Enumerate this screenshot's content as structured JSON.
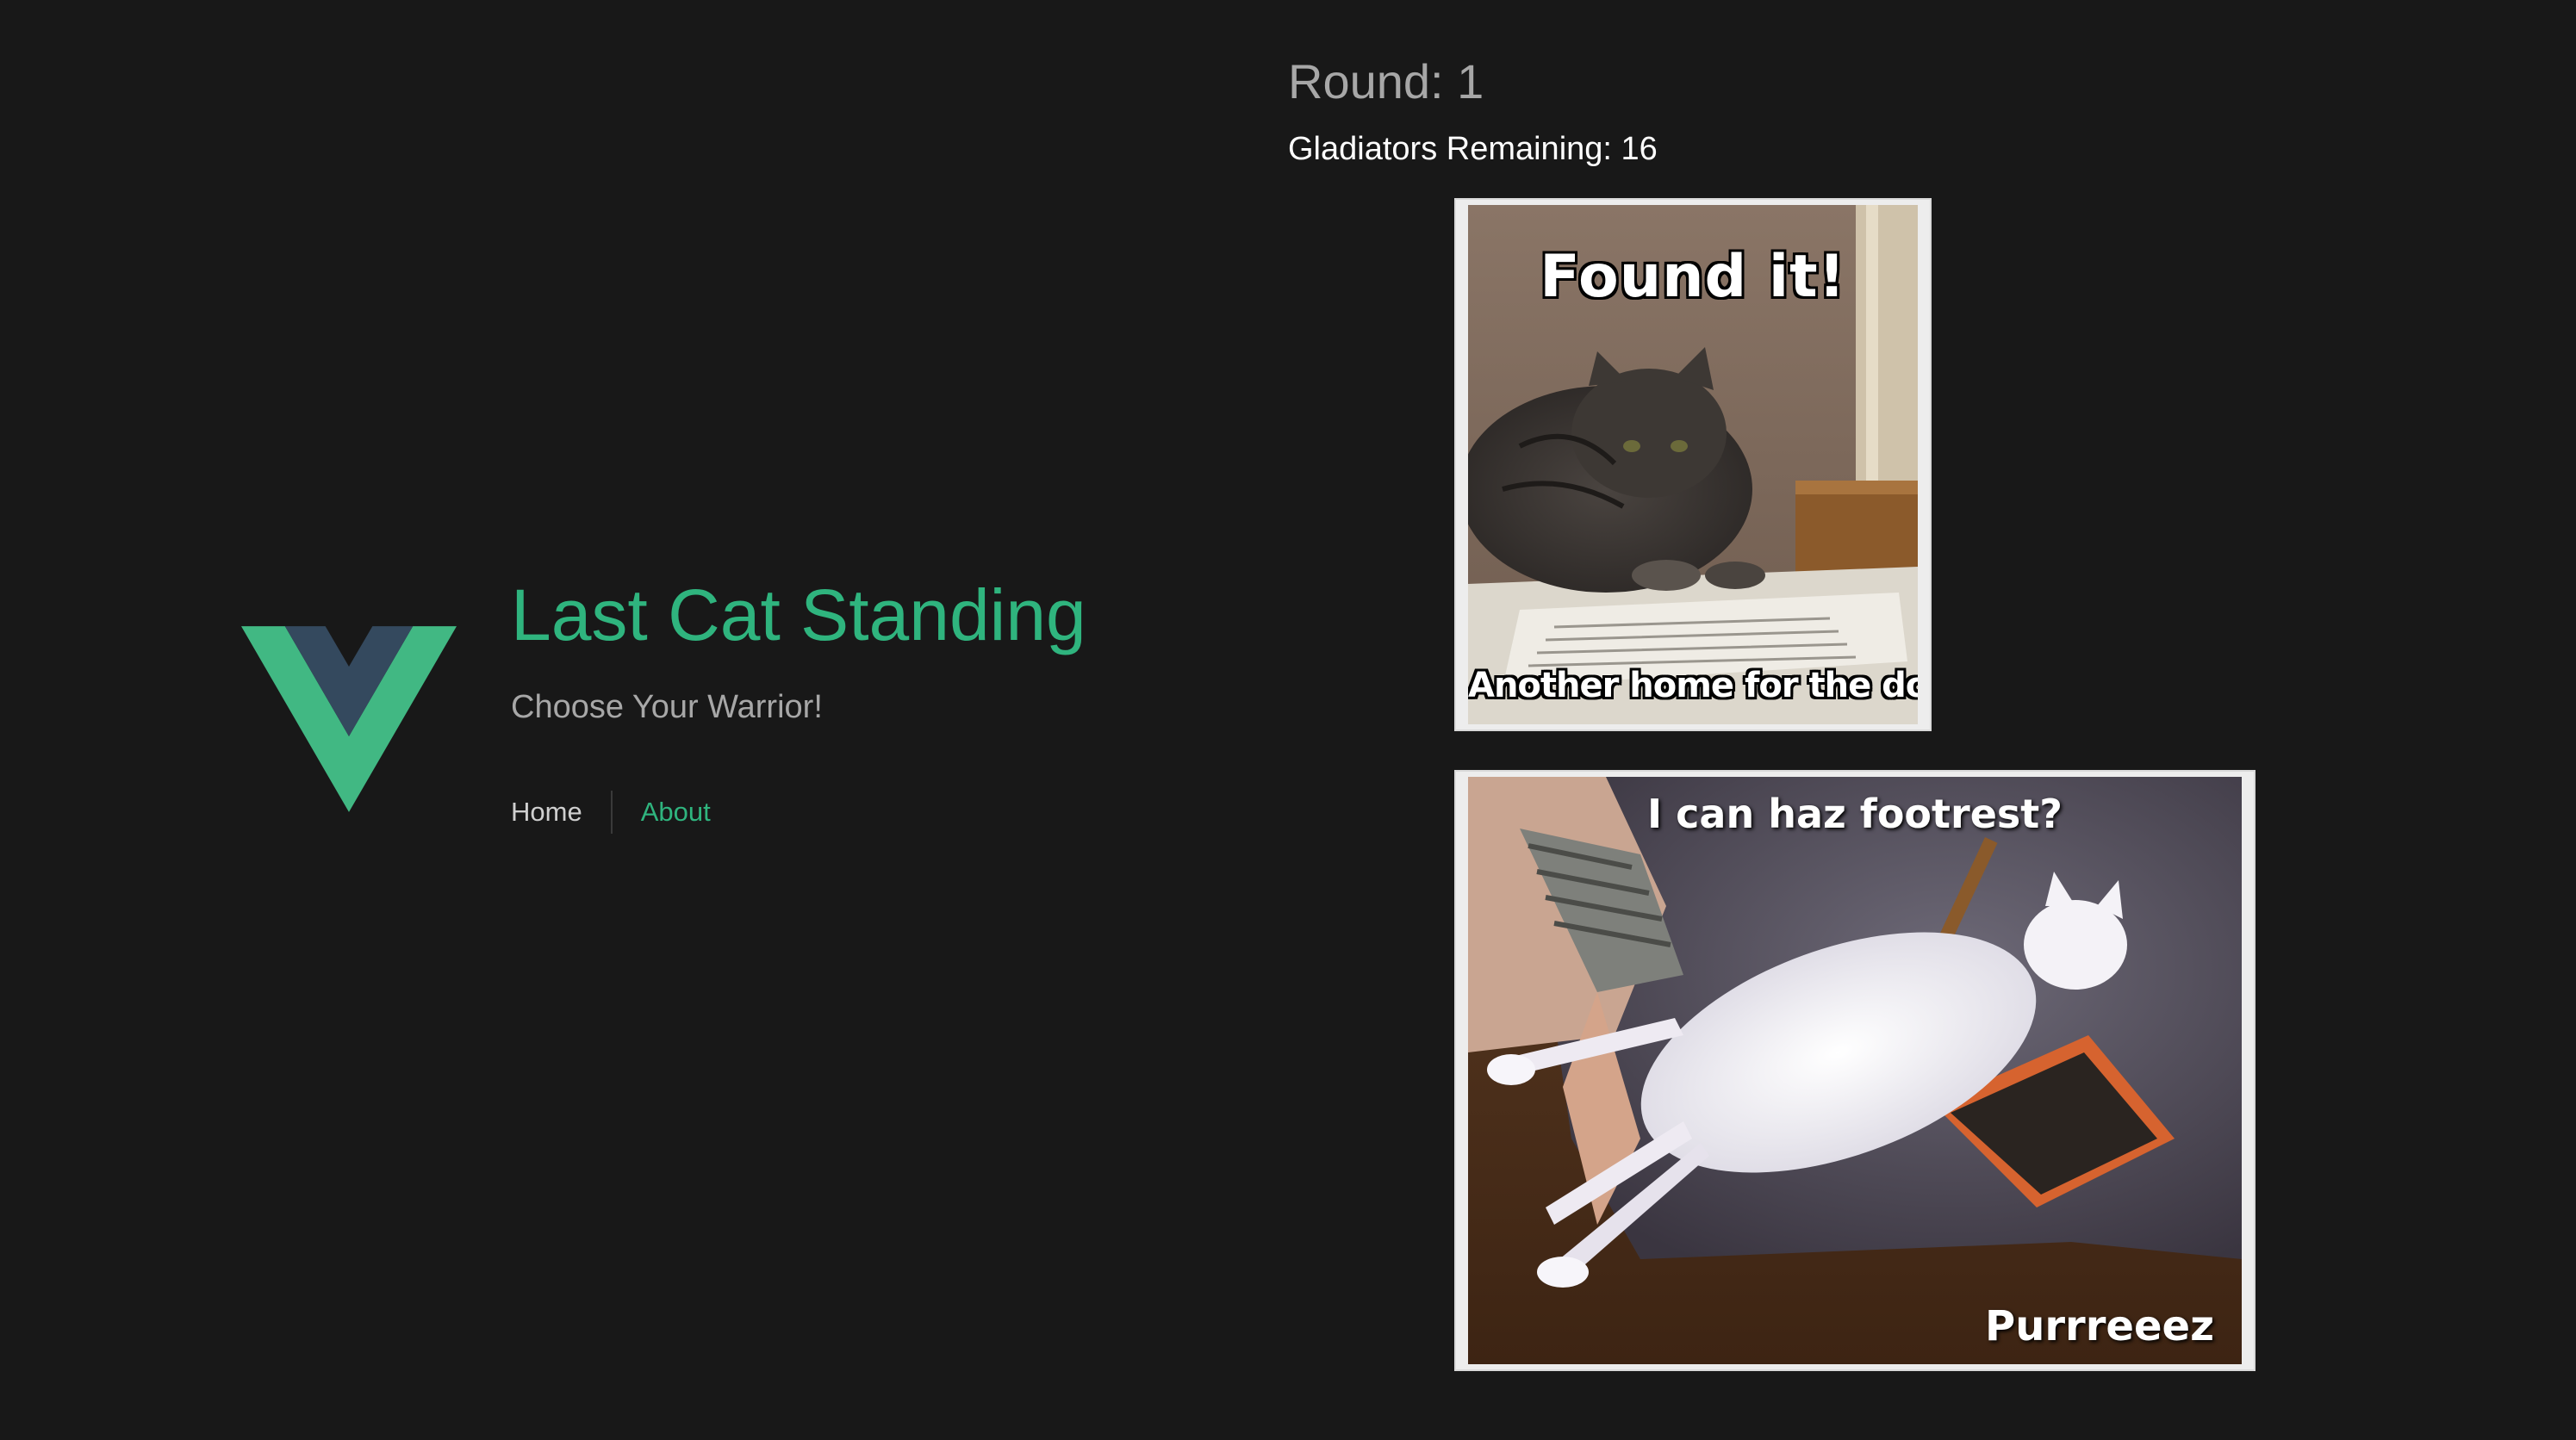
{
  "header": {
    "title": "Last Cat Standing",
    "subtitle": "Choose Your Warrior!",
    "logo_icon": "vue-logo-icon",
    "colors": {
      "accent": "#2fb47e",
      "logo_green": "#41b883",
      "logo_navy": "#34495e"
    }
  },
  "nav": {
    "items": [
      {
        "label": "Home"
      },
      {
        "label": "About"
      }
    ]
  },
  "game": {
    "round_label": "Round: 1",
    "remaining_label": "Gladiators Remaining: 16",
    "gladiators": [
      {
        "caption_top": "Found it!",
        "caption_bottom": "Another home for the dog!"
      },
      {
        "caption_top": "I can haz footrest?",
        "caption_bottom": "Purrreeez"
      }
    ]
  }
}
